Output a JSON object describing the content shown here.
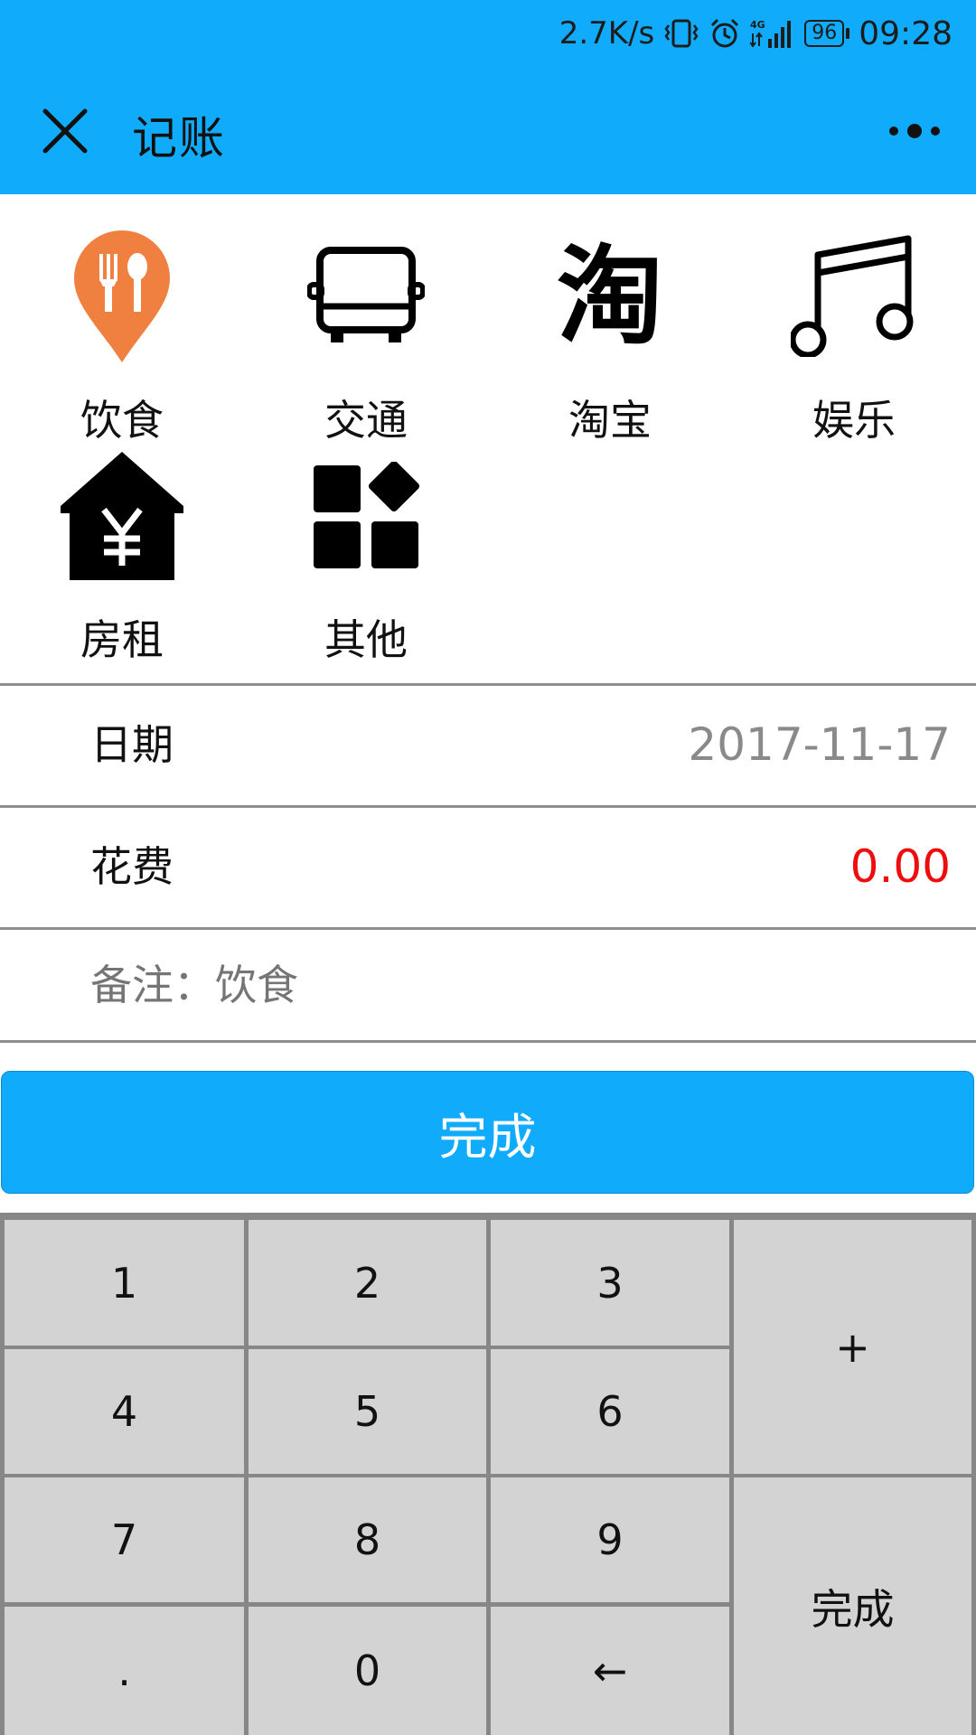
{
  "status_bar": {
    "net_speed": "2.7K/s",
    "battery": "96",
    "time": "09:28",
    "icons": [
      "vibrate-icon",
      "alarm-icon",
      "signal-4g-icon",
      "battery-icon"
    ]
  },
  "header": {
    "title": "记账",
    "close_icon": "close-icon",
    "more_icon": "more-icon",
    "background": "#11abfb"
  },
  "categories": [
    {
      "label": "饮食",
      "icon": "food-pin-icon",
      "color": "#f08040"
    },
    {
      "label": "交通",
      "icon": "bus-icon",
      "color": "#000000"
    },
    {
      "label": "淘宝",
      "icon": "taobao-icon",
      "glyph": "淘",
      "color": "#000000"
    },
    {
      "label": "娱乐",
      "icon": "music-note-icon",
      "color": "#000000"
    },
    {
      "label": "房租",
      "icon": "house-yen-icon",
      "glyph": "¥",
      "color": "#000000"
    },
    {
      "label": "其他",
      "icon": "other-grid-icon",
      "color": "#000000"
    }
  ],
  "form": {
    "date_label": "日期",
    "date_value": "2017-11-17",
    "amount_label": "花费",
    "amount_value": "0.00",
    "amount_color": "#ee0d0d",
    "remark_placeholder": "备注：饮食"
  },
  "done_button": "完成",
  "keypad": {
    "keys": [
      "1",
      "2",
      "3",
      "4",
      "5",
      "6",
      "7",
      "8",
      "9",
      ".",
      "0",
      "←"
    ],
    "plus": "+",
    "done": "完成"
  }
}
